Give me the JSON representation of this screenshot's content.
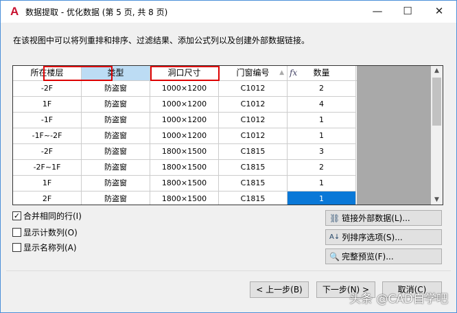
{
  "window": {
    "title": "数据提取 - 优化数据 (第 5 页, 共 8 页)",
    "app_icon": "A",
    "minimize": "—",
    "maximize": "☐",
    "close": "✕"
  },
  "description": "在该视图中可以将列重排和排序、过滤结果、添加公式列以及创建外部数据链接。",
  "table": {
    "headers": [
      "所在楼层",
      "类型",
      "洞口尺寸",
      "门窗编号",
      "数量"
    ],
    "sort_icon": "▲",
    "fx_icon": "fx",
    "rows": [
      [
        "-2F",
        "防盗窗",
        "1000×1200",
        "C1012",
        "2"
      ],
      [
        "1F",
        "防盗窗",
        "1000×1200",
        "C1012",
        "4"
      ],
      [
        "-1F",
        "防盗窗",
        "1000×1200",
        "C1012",
        "1"
      ],
      [
        "-1F~-2F",
        "防盗窗",
        "1000×1200",
        "C1012",
        "1"
      ],
      [
        "-2F",
        "防盗窗",
        "1800×1500",
        "C1815",
        "3"
      ],
      [
        "-2F~1F",
        "防盗窗",
        "1800×1500",
        "C1815",
        "2"
      ],
      [
        "1F",
        "防盗窗",
        "1800×1500",
        "C1815",
        "1"
      ],
      [
        "2F",
        "防盗窗",
        "1800×1500",
        "C1815",
        "1"
      ]
    ]
  },
  "options": [
    {
      "label": "合并相同的行(I)",
      "checked": true
    },
    {
      "label": "显示计数列(O)",
      "checked": false
    },
    {
      "label": "显示名称列(A)",
      "checked": false
    }
  ],
  "side_buttons": [
    "链接外部数据(L)...",
    "列排序选项(S)...",
    "完整预览(F)..."
  ],
  "footer": {
    "back": "< 上一步(B)",
    "next": "下一步(N) >",
    "cancel": "取消(C)"
  },
  "watermark": "头条 @CAD自学吧"
}
